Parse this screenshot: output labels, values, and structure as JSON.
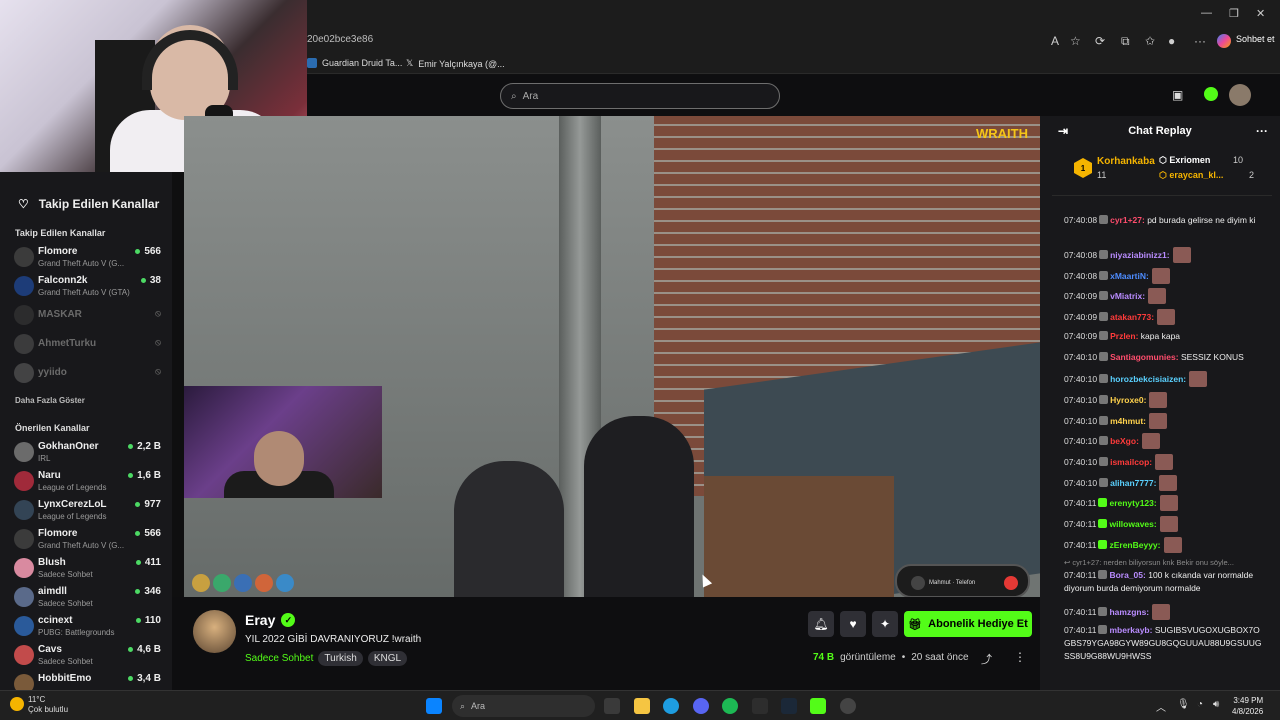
{
  "browser": {
    "url_fragment": "20e02bce3e86",
    "chat_button": "Sohbet et",
    "bookmarks": [
      {
        "label": "Guardian Druid Ta...",
        "color": "#2b6cb0"
      },
      {
        "label": "Emir Yalçınkaya (@...",
        "color": "#000000"
      }
    ]
  },
  "search": {
    "placeholder": "Ara"
  },
  "sidebar": {
    "title": "Takip Edilen Kanallar",
    "followed_section": "Takip Edilen Kanallar",
    "followed": [
      {
        "name": "Flomore",
        "game": "Grand Theft Auto V (G...",
        "viewers": "566",
        "online": true,
        "color": "#3b3b3b"
      },
      {
        "name": "Falconn2k",
        "game": "Grand Theft Auto V (GTA)",
        "viewers": "38",
        "online": true,
        "color": "#1d3c78"
      },
      {
        "name": "MASKAR",
        "game": "",
        "viewers": "",
        "online": false,
        "color": "#444444"
      },
      {
        "name": "AhmetTurku",
        "game": "",
        "viewers": "",
        "online": false,
        "color": "#666666"
      },
      {
        "name": "yyiido",
        "game": "",
        "viewers": "",
        "online": false,
        "color": "#777777"
      }
    ],
    "show_more": "Daha Fazla Göster",
    "recommended_section": "Önerilen Kanallar",
    "recommended": [
      {
        "name": "GokhanOner",
        "game": "IRL",
        "viewers": "2,2 B",
        "color": "#6b6b6b"
      },
      {
        "name": "Naru",
        "game": "League of Legends",
        "viewers": "1,6 B",
        "color": "#a02a3a"
      },
      {
        "name": "LynxCerezLoL",
        "game": "League of Legends",
        "viewers": "977",
        "color": "#334455"
      },
      {
        "name": "Flomore",
        "game": "Grand Theft Auto V (G...",
        "viewers": "566",
        "color": "#3b3b3b"
      },
      {
        "name": "Blush",
        "game": "Sadece Sohbet",
        "viewers": "411",
        "color": "#d98aa0"
      },
      {
        "name": "aimdll",
        "game": "Sadece Sohbet",
        "viewers": "346",
        "color": "#5a6a8a"
      },
      {
        "name": "ccinext",
        "game": "PUBG: Battlegrounds",
        "viewers": "110",
        "color": "#2a5a9a"
      },
      {
        "name": "Cavs",
        "game": "Sadece Sohbet",
        "viewers": "4,6 B",
        "color": "#c24b4b"
      },
      {
        "name": "HobbitEmo",
        "game": "",
        "viewers": "3,4 B",
        "color": "#7a5a3a"
      }
    ]
  },
  "video": {
    "overlay_text": "WRAITH",
    "phone_name": "Mahmut · Telefon"
  },
  "stream": {
    "streamer": "Eray",
    "title": "YIL 2022 GİBİ DAVRANIYORUZ  !wraith",
    "category": "Sadece Sohbet",
    "tags": [
      "Turkish",
      "KNGL"
    ],
    "subscribe_gift": "Abonelik Hediye Et",
    "views": "74 B",
    "views_label": "görüntüleme",
    "ago": "20 saat önce"
  },
  "chat": {
    "title": "Chat Replay",
    "leaderboard": [
      {
        "rank": "1",
        "name": "Korhankaba",
        "count": "11"
      },
      {
        "name": "Exriomen",
        "count": "10"
      },
      {
        "name": "eraycan_kl...",
        "count": "2"
      }
    ],
    "messages": [
      {
        "time": "07:40:08",
        "user": "cyr1+27:",
        "color": "#ff4d6d",
        "text": " pd burada gelirse ne diyim ki",
        "emote": false
      },
      {
        "time": "07:40:08",
        "user": "niyaziabinizz1:",
        "color": "#b98cff",
        "text": "",
        "emote": true
      },
      {
        "time": "07:40:08",
        "user": "xMaartiN:",
        "color": "#4d8cff",
        "text": "",
        "emote": true
      },
      {
        "time": "07:40:09",
        "user": "vMiatrix:",
        "color": "#b98cff",
        "text": "",
        "emote": true
      },
      {
        "time": "07:40:09",
        "user": "atakan773:",
        "color": "#ff3b3b",
        "text": "",
        "emote": true
      },
      {
        "time": "07:40:09",
        "user": "Przlen:",
        "color": "#ff3b3b",
        "text": " kapa kapa",
        "emote": false
      },
      {
        "time": "07:40:10",
        "user": "Santiagomunies:",
        "color": "#ff4d6d",
        "text": " SESSIZ KONUS",
        "emote": false
      },
      {
        "time": "07:40:10",
        "user": "horozbekcisiaizen:",
        "color": "#5ad1ff",
        "text": "",
        "emote": true
      },
      {
        "time": "07:40:10",
        "user": "Hyroxe0:",
        "color": "#ffd24d",
        "text": "",
        "emote": true
      },
      {
        "time": "07:40:10",
        "user": "m4hmut:",
        "color": "#ffd24d",
        "text": "",
        "emote": true
      },
      {
        "time": "07:40:10",
        "user": "beXgo:",
        "color": "#ff3b3b",
        "text": "",
        "emote": true
      },
      {
        "time": "07:40:10",
        "user": "ismailcop:",
        "color": "#ff3b3b",
        "text": "",
        "emote": true
      },
      {
        "time": "07:40:10",
        "user": "alihan7777:",
        "color": "#5ad1ff",
        "text": "",
        "emote": true
      },
      {
        "time": "07:40:11",
        "user": "erenyty123:",
        "color": "#53fc18",
        "text": "",
        "emote": true
      },
      {
        "time": "07:40:11",
        "user": "willowaves:",
        "color": "#53fc18",
        "text": "",
        "emote": true
      },
      {
        "time": "07:40:11",
        "user": "zErenBeyyy:",
        "color": "#53fc18",
        "text": "",
        "emote": true
      }
    ],
    "reply_ref": "cyr1+27: nerden biliyorsun knk Bekir onu söyle...",
    "reply": {
      "time": "07:40:11",
      "user": "Bora_05:",
      "color": "#b98cff",
      "text": " 100 k cıkanda var normalde diyorum burda demiyorum normalde"
    },
    "after": [
      {
        "time": "07:40:11",
        "user": "hamzgns:",
        "color": "#b98cff",
        "text": "",
        "emote": true
      },
      {
        "time": "07:40:11",
        "user": "mberkayb:",
        "color": "#b98cff",
        "text": " SUGIBSVUGOXUGBOX7OGBS79YGA98GYW89GU8GQGUUAU88U9GSUUGSS8U9G88WU9HWSS",
        "emote": false
      }
    ]
  },
  "taskbar": {
    "temp": "11°C",
    "weather": "Çok bulutlu",
    "search": "Ara",
    "time": "3:49 PM",
    "date": "4/8/2026"
  }
}
